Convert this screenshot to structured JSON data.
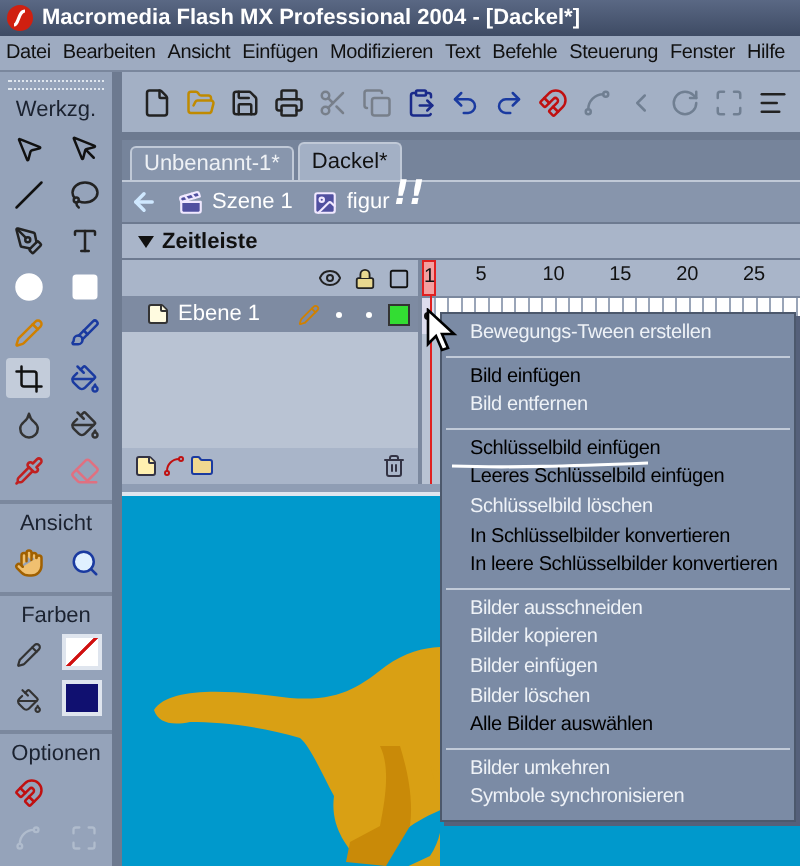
{
  "window": {
    "title": "Macromedia Flash MX Professional 2004 - [Dackel*]"
  },
  "menu": [
    "Datei",
    "Bearbeiten",
    "Ansicht",
    "Einfügen",
    "Modifizieren",
    "Text",
    "Befehle",
    "Steuerung",
    "Fenster",
    "Hilfe"
  ],
  "toolbar": [
    {
      "kind": "new",
      "disabled": false
    },
    {
      "kind": "open",
      "disabled": false
    },
    {
      "kind": "save",
      "disabled": false
    },
    {
      "kind": "print",
      "disabled": false
    },
    {
      "kind": "cut",
      "disabled": true
    },
    {
      "kind": "copy",
      "disabled": true
    },
    {
      "kind": "paste",
      "disabled": false
    },
    {
      "kind": "undo",
      "disabled": false
    },
    {
      "kind": "redo",
      "disabled": false
    },
    {
      "kind": "magnet",
      "disabled": false
    },
    {
      "kind": "smooth",
      "disabled": true
    },
    {
      "kind": "straighten",
      "disabled": true
    },
    {
      "kind": "rotate",
      "disabled": true
    },
    {
      "kind": "scale",
      "disabled": true
    },
    {
      "kind": "align",
      "disabled": false
    }
  ],
  "tools": {
    "title": "Werkzg.",
    "view_title": "Ansicht",
    "colors_title": "Farben",
    "options_title": "Optionen"
  },
  "document_tabs": [
    {
      "label": "Unbenannt-1*",
      "selected": false
    },
    {
      "label": "Dackel*",
      "selected": true
    }
  ],
  "breadcrumb": [
    {
      "kind": "scene",
      "label": "Szene 1"
    },
    {
      "kind": "symbol",
      "label": "figur"
    }
  ],
  "annotation": "!!",
  "timeline": {
    "title": "Zeitleiste",
    "expanded": true,
    "ruler": [
      "1",
      "5",
      "10",
      "15",
      "20",
      "25"
    ],
    "layers": [
      {
        "name": "Ebene 1",
        "selected": true,
        "color": "#33dd33"
      }
    ]
  },
  "context_menu": {
    "groups": [
      [
        {
          "label": "Bewegungs-Tween erstellen",
          "disabled": true,
          "underlined": false
        }
      ],
      [
        {
          "label": "Bild einfügen",
          "disabled": false,
          "underlined": false
        },
        {
          "label": "Bild entfernen",
          "disabled": true,
          "underlined": false
        }
      ],
      [
        {
          "label": "Schlüsselbild einfügen",
          "disabled": false,
          "underlined": true
        },
        {
          "label": "Leeres Schlüsselbild einfügen",
          "disabled": false,
          "underlined": false
        },
        {
          "label": "Schlüsselbild löschen",
          "disabled": true,
          "underlined": false
        },
        {
          "label": "In Schlüsselbilder konvertieren",
          "disabled": false,
          "underlined": false
        },
        {
          "label": "In leere Schlüsselbilder konvertieren",
          "disabled": false,
          "underlined": false
        }
      ],
      [
        {
          "label": "Bilder ausschneiden",
          "disabled": true,
          "underlined": false
        },
        {
          "label": "Bilder kopieren",
          "disabled": true,
          "underlined": false
        },
        {
          "label": "Bilder einfügen",
          "disabled": true,
          "underlined": false
        },
        {
          "label": "Bilder löschen",
          "disabled": true,
          "underlined": false
        },
        {
          "label": "Alle Bilder auswählen",
          "disabled": false,
          "underlined": false
        }
      ],
      [
        {
          "label": "Bilder umkehren",
          "disabled": true,
          "underlined": false
        },
        {
          "label": "Symbole synchronisieren",
          "disabled": true,
          "underlined": false
        }
      ]
    ]
  }
}
